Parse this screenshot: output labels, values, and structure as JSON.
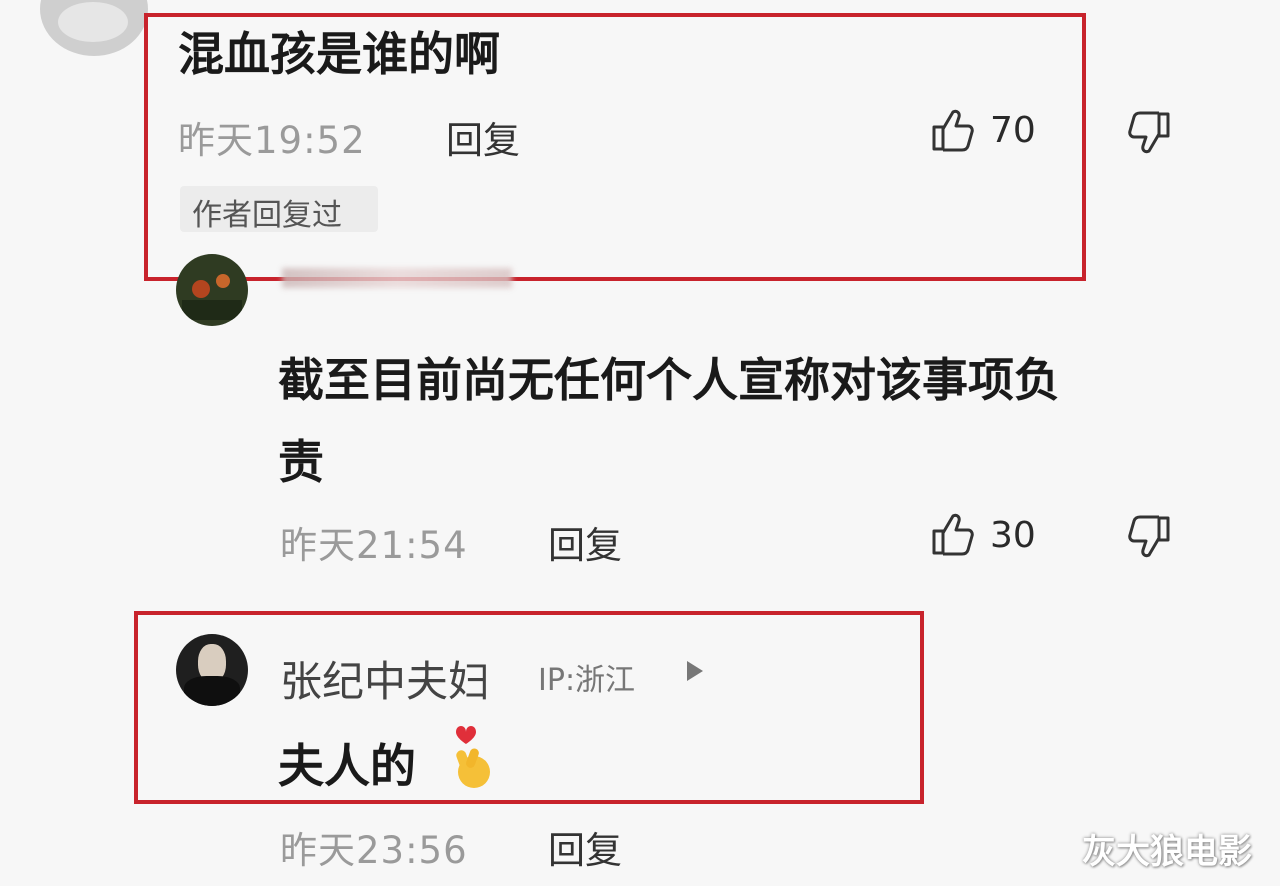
{
  "comments": [
    {
      "text": "混血孩是谁的啊",
      "time": "昨天19:52",
      "reply_label": "回复",
      "likes": "70",
      "author_badge": "作者回复过"
    },
    {
      "text_line1": "截至目前尚无任何个人宣称对该事项负",
      "text_line2": "责",
      "time": "昨天21:54",
      "reply_label": "回复",
      "likes": "30"
    },
    {
      "username": "张纪中夫妇",
      "ip": "IP:浙江",
      "text": "夫人的",
      "time": "昨天23:56",
      "reply_label": "回复"
    }
  ],
  "watermark": "灰大狼电影",
  "colors": {
    "highlight_box": "#c8232c",
    "time_text": "#9a9a9a",
    "badge_bg": "#ececec"
  }
}
